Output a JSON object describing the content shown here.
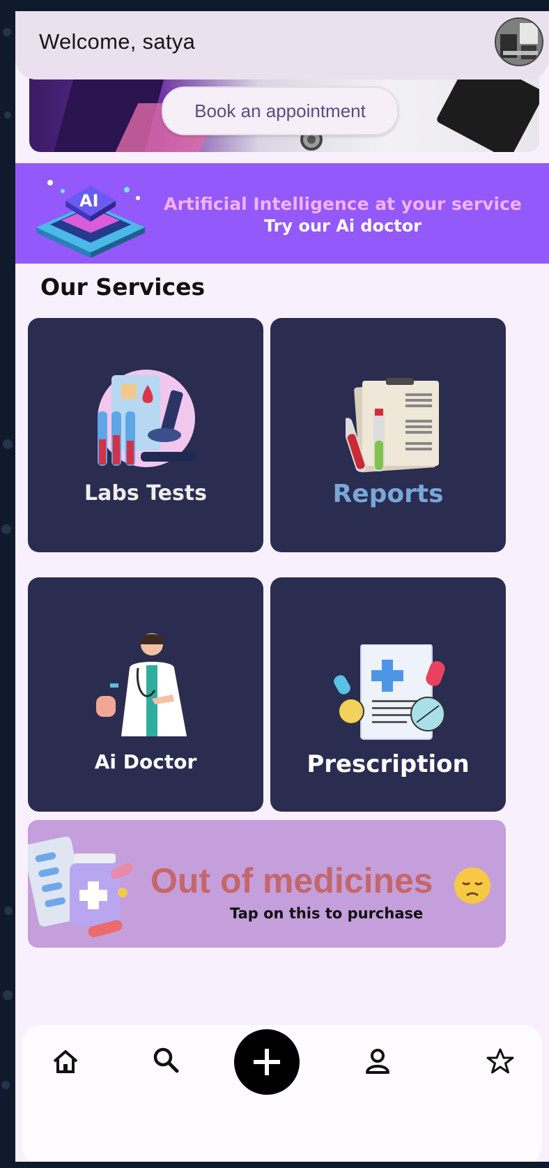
{
  "header": {
    "welcome_text": "Welcome, satya"
  },
  "banner": {
    "book_button_label": "Book an appointment"
  },
  "ai_banner": {
    "line1": "Artificial Intelligence at your service",
    "line2": "Try our Ai doctor"
  },
  "services": {
    "title": "Our Services",
    "cards": [
      {
        "label": "Labs Tests",
        "color": "#ededed"
      },
      {
        "label": "Reports",
        "color": "#7aa6d8"
      },
      {
        "label": "Ai Doctor",
        "color": "#ffffff"
      },
      {
        "label": "Prescription",
        "color": "#ffffff"
      }
    ]
  },
  "medicine_banner": {
    "title": "Out of medicines",
    "subtitle": "Tap on this to purchase"
  },
  "bottom_nav": {
    "items": [
      {
        "icon": "home-icon"
      },
      {
        "icon": "search-icon"
      },
      {
        "icon": "add-icon"
      },
      {
        "icon": "profile-icon"
      },
      {
        "icon": "star-icon"
      }
    ]
  },
  "colors": {
    "ai_banner_bg": "#9359fa",
    "card_bg": "#2a2c50",
    "medicine_banner_bg": "#c49fdb",
    "page_bg": "#f8f1fd"
  }
}
